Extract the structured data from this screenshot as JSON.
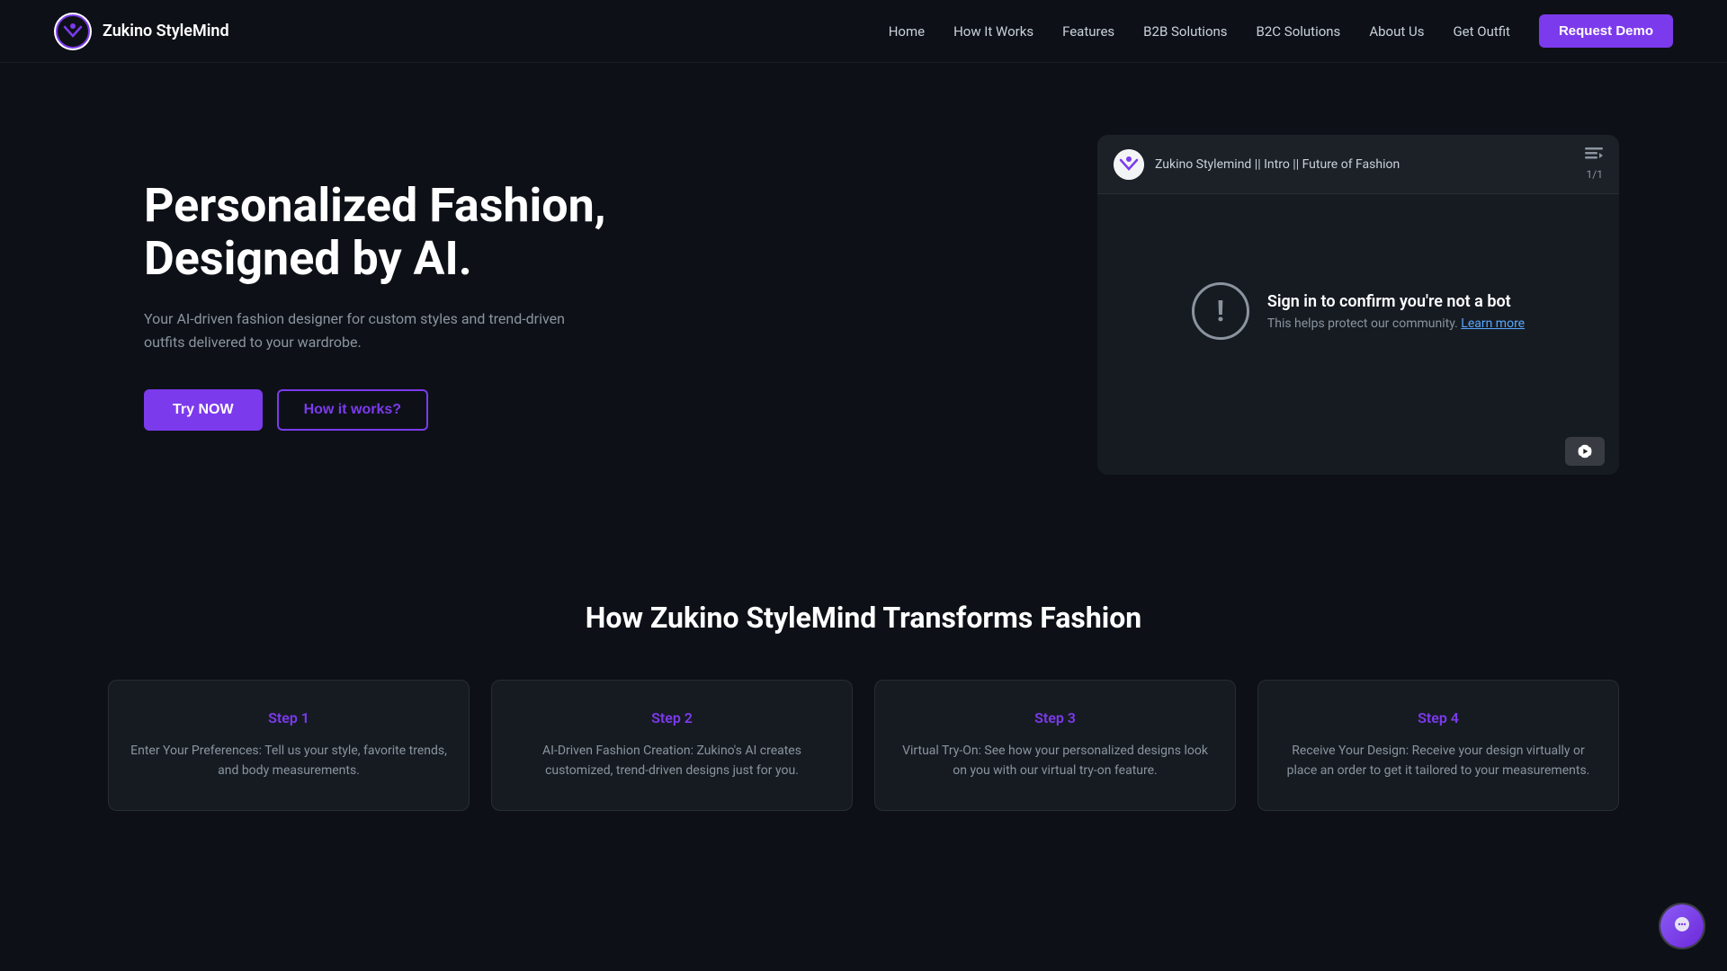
{
  "brand": {
    "name": "Zukino StyleMind"
  },
  "nav": {
    "links": [
      {
        "id": "home",
        "label": "Home"
      },
      {
        "id": "how-it-works",
        "label": "How It Works"
      },
      {
        "id": "features",
        "label": "Features"
      },
      {
        "id": "b2b-solutions",
        "label": "B2B Solutions"
      },
      {
        "id": "b2c-solutions",
        "label": "B2C Solutions"
      },
      {
        "id": "about-us",
        "label": "About Us"
      },
      {
        "id": "get-outfit",
        "label": "Get Outfit"
      }
    ],
    "cta_label": "Request Demo"
  },
  "hero": {
    "title": "Personalized Fashion, Designed by AI.",
    "subtitle": "Your AI-driven fashion designer for custom styles and trend-driven outfits delivered to your wardrobe.",
    "btn_try_now": "Try NOW",
    "btn_how_it_works": "How it works?"
  },
  "video": {
    "channel_name": "Zukino Stylemind || Intro || Future of Fashion",
    "playlist_count": "1/1",
    "sign_in_heading": "Sign in to confirm you're not a bot",
    "sign_in_body": "This helps protect our community.",
    "learn_more_label": "Learn more"
  },
  "how_it_works": {
    "section_title": "How Zukino StyleMind Transforms Fashion",
    "steps": [
      {
        "label": "Step 1",
        "description": "Enter Your Preferences: Tell us your style, favorite trends, and body measurements."
      },
      {
        "label": "Step 2",
        "description": "AI-Driven Fashion Creation: Zukino's AI creates customized, trend-driven designs just for you."
      },
      {
        "label": "Step 3",
        "description": "Virtual Try-On: See how your personalized designs look on you with our virtual try-on feature."
      },
      {
        "label": "Step 4",
        "description": "Receive Your Design: Receive your design virtually or place an order to get it tailored to your measurements."
      }
    ]
  },
  "colors": {
    "accent": "#7c3aed",
    "bg": "#0d1117",
    "card_bg": "#161b22",
    "text_muted": "#8b949e"
  }
}
